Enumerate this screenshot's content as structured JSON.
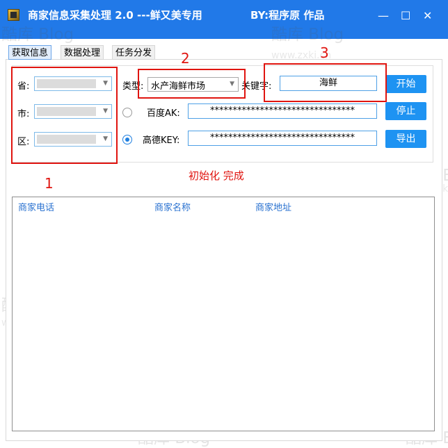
{
  "window": {
    "title": "商家信息采集处理 2.0 ---鲜又美专用",
    "byline": "BY:程序原 作品",
    "minimize_glyph": "—",
    "maximize_glyph": "☐",
    "close_glyph": "✕"
  },
  "tabs": [
    {
      "label": "获取信息",
      "active": true
    },
    {
      "label": "数据处理",
      "active": false
    },
    {
      "label": "任务分发",
      "active": false
    }
  ],
  "form": {
    "province_label": "省:",
    "city_label": "市:",
    "district_label": "区:",
    "type_label": "类型:",
    "type_value": "水产海鲜市场",
    "keyword_label": "关键字:",
    "keyword_value": "海鲜",
    "baidu_ak_label": "百度AK:",
    "baidu_ak_value": "********************************",
    "gaode_key_label": "高德KEY:",
    "gaode_key_value": "********************************",
    "radio_selected": "gaode"
  },
  "buttons": {
    "start": "开始",
    "stop": "停止",
    "export": "导出"
  },
  "status": "初始化 完成",
  "table": {
    "columns": [
      "商家电话",
      "商家名称",
      "商家地址"
    ],
    "rows": []
  },
  "annotations": [
    "1",
    "2",
    "3"
  ],
  "watermark": {
    "logo": "酷库 Blog",
    "url": "www.zxki.cn"
  },
  "colors": {
    "titlebar": "#2179e8",
    "accent_button": "#1e93f2",
    "annotation_red": "#e0140f",
    "column_header": "#2a72d0"
  }
}
